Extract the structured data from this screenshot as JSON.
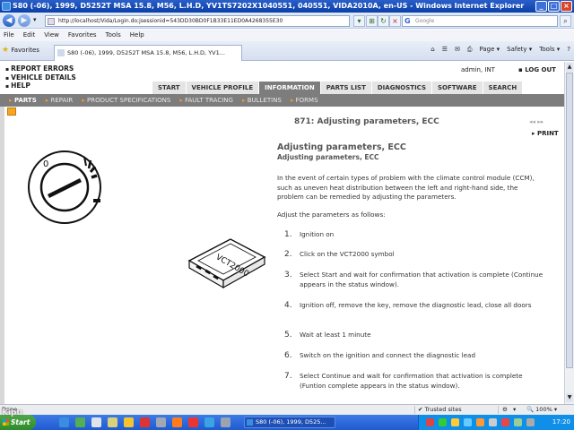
{
  "window": {
    "title": "S80 (-06), 1999, D5252T MSA 15.8, M56, L.H.D, YV1TS7202X1040551, 040551, VIDA2010A, en-US - Windows Internet Explorer"
  },
  "browser": {
    "url": "http://localhost/Vida/Login.do;jsessionid=543DD30BD0F1B33E11ED0A4268355E30",
    "search_placeholder": "Google",
    "menu": [
      "File",
      "Edit",
      "View",
      "Favorites",
      "Tools",
      "Help"
    ],
    "favorites_label": "Favorites",
    "tab_title": "S80 (-06), 1999, D5252T MSA 15.8, M56, L.H.D, YV1...",
    "commands": [
      "Page ▾",
      "Safety ▾",
      "Tools ▾"
    ]
  },
  "vida": {
    "top_links": [
      "REPORT ERRORS",
      "VEHICLE DETAILS",
      "HELP"
    ],
    "user": "admin, INT",
    "logout": "LOG OUT",
    "tabs": [
      {
        "label": "START"
      },
      {
        "label": "VEHICLE PROFILE"
      },
      {
        "label": "INFORMATION",
        "active": true
      },
      {
        "label": "PARTS LIST"
      },
      {
        "label": "DIAGNOSTICS"
      },
      {
        "label": "SOFTWARE"
      },
      {
        "label": "SEARCH"
      }
    ],
    "subnav": [
      {
        "label": "PARTS",
        "active": true
      },
      {
        "label": "REPAIR"
      },
      {
        "label": "PRODUCT SPECIFICATIONS"
      },
      {
        "label": "FAULT TRACING"
      },
      {
        "label": "BULLETINS"
      },
      {
        "label": "FORMS"
      }
    ],
    "doc_title": "871: Adjusting parameters, ECC",
    "pager": "◂◂  ▸▸",
    "print": "PRINT",
    "device_label": "VCT2000"
  },
  "document": {
    "heading": "Adjusting parameters, ECC",
    "subheading": "Adjusting parameters, ECC",
    "intro": "In the event of certain types of problem with the climate control module (CCM), such as uneven heat distribution between the left and right-hand side, the problem can be remedied by adjusting the parameters.",
    "adjust_label": "Adjust the parameters as follows:",
    "steps": [
      {
        "num": "1.",
        "text": "Ignition on"
      },
      {
        "num": "2.",
        "text": "Click on the VCT2000 symbol"
      },
      {
        "num": "3.",
        "text": "Select Start and wait for confirmation that activation is complete (Continue appears in the status window)."
      },
      {
        "num": "4.",
        "text": "Ignition off, remove the key, remove the diagnostic lead, close all doors"
      },
      {
        "num": "5.",
        "text": "Wait at least 1 minute"
      },
      {
        "num": "6.",
        "text": "Switch on the ignition and connect the diagnostic lead"
      },
      {
        "num": "7.",
        "text": "Select Continue and wait for confirmation that activation is complete (Funtion complete appears in the status window)."
      }
    ]
  },
  "statusbar": {
    "left": "Done",
    "trusted": "Trusted sites",
    "zoom": "100%"
  },
  "taskbar": {
    "start": "Start",
    "task_item": "S80 (-06), 1999, D525...",
    "clock": "17:20"
  },
  "watermark": "Kipu"
}
